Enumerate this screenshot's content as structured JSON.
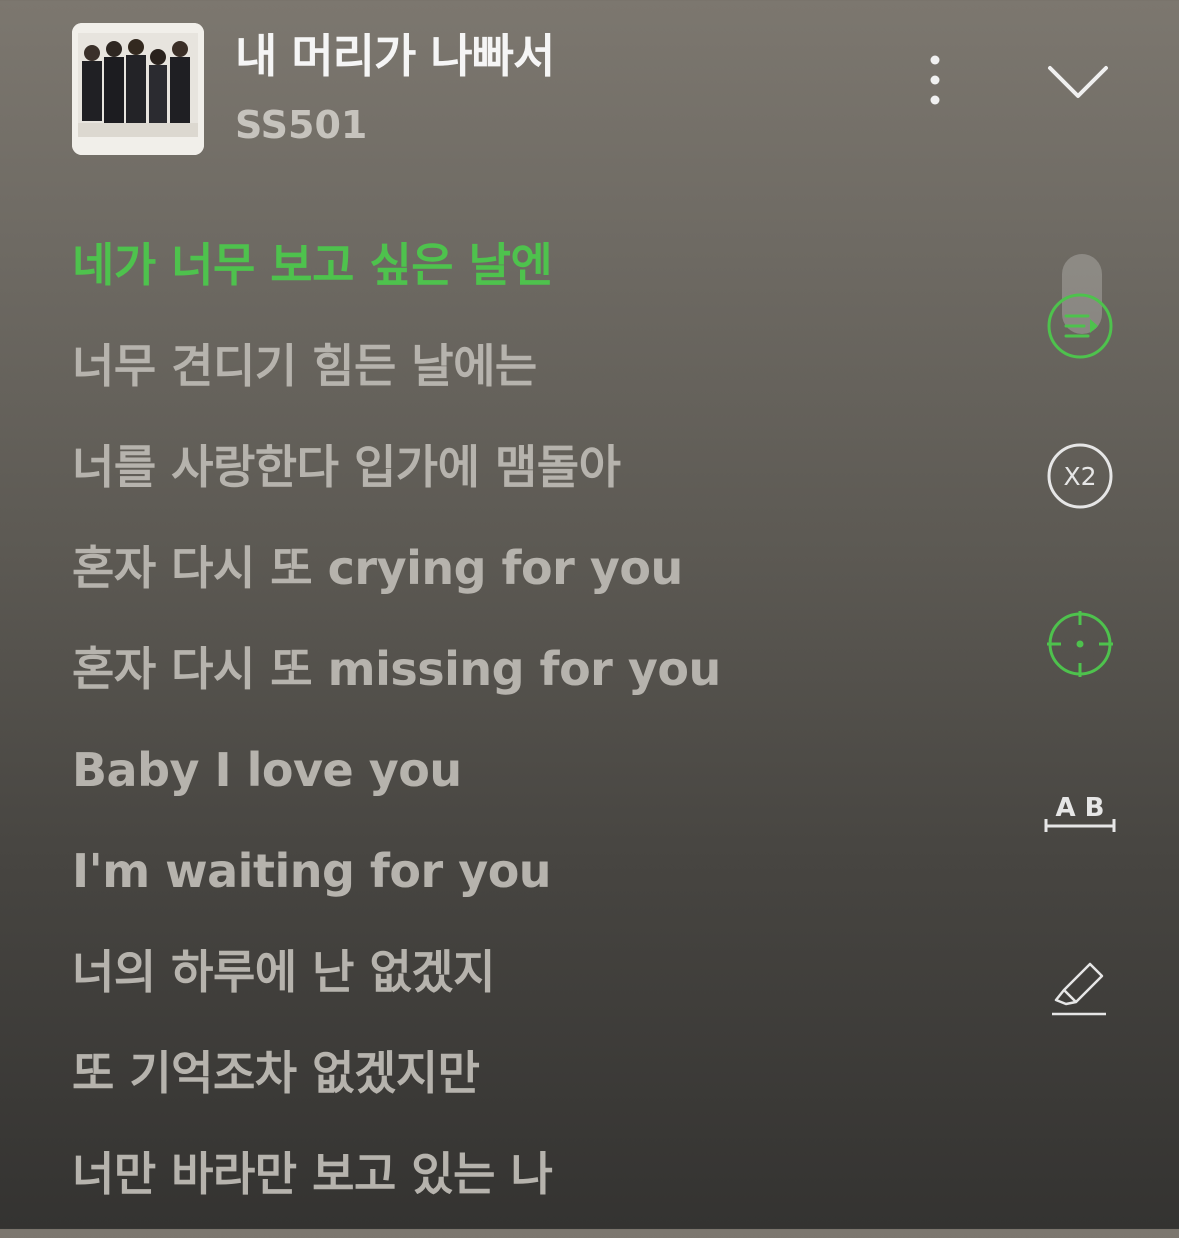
{
  "player": {
    "song_title": "내 머리가 나빠서",
    "artist": "SS501"
  },
  "icons": {
    "more": "more-vertical-icon",
    "collapse": "chevron-down-icon",
    "autoscroll": "lyrics-play-icon",
    "speed": "speed-x2-icon",
    "focus": "crosshair-icon",
    "font_size": "ab-text-size-icon",
    "highlight": "highlighter-icon"
  },
  "speed_label": "X2",
  "font_size_label": "A B",
  "colors": {
    "accent": "#4ec24d",
    "lyric_text": "#b6b3ad",
    "title_text": "#f5f5f5"
  },
  "lyrics": [
    "네가 너무 보고 싶은 날엔",
    "너무 견디기 힘든 날에는",
    "너를 사랑한다 입가에 맴돌아",
    "혼자 다시 또 crying for you",
    "혼자 다시 또 missing for you",
    "Baby I love you",
    "I'm waiting for you",
    "너의 하루에 난 없겠지",
    "또 기억조차 없겠지만",
    "너만 바라만 보고 있는 나"
  ],
  "active_lyric_index": 0
}
